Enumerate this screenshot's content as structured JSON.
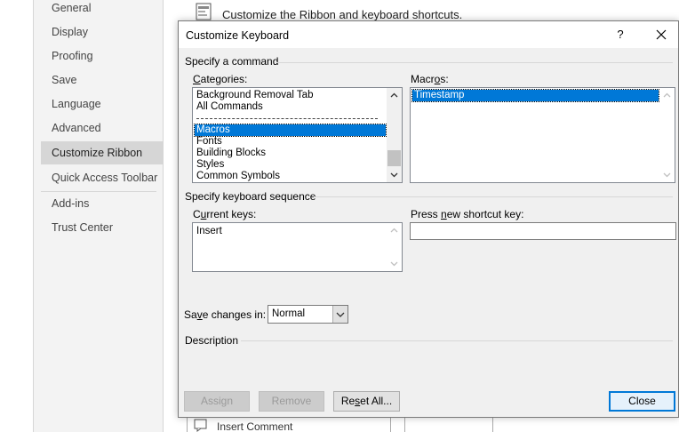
{
  "background_window": {
    "sidebar": {
      "items": [
        {
          "label": "General"
        },
        {
          "label": "Display"
        },
        {
          "label": "Proofing"
        },
        {
          "label": "Save"
        },
        {
          "label": "Language"
        },
        {
          "label": "Advanced"
        },
        {
          "label": "Customize Ribbon",
          "active": true
        },
        {
          "label": "Quick Access Toolbar"
        },
        {
          "label": "Add-ins"
        },
        {
          "label": "Trust Center"
        }
      ]
    },
    "header_text": "Customize the Ribbon and keyboard shortcuts.",
    "partial_list_item": "Insert Comment"
  },
  "dialog": {
    "title": "Customize Keyboard",
    "help_glyph": "?",
    "specify_command_label": "Specify a command",
    "categories": {
      "label_pre": "",
      "label_ul": "C",
      "label_post": "ategories:",
      "items": [
        "Background Removal Tab",
        "All Commands",
        "Macros",
        "Fonts",
        "Building Blocks",
        "Styles",
        "Common Symbols"
      ],
      "selected": "Macros"
    },
    "macros": {
      "label_pre": "Macr",
      "label_ul": "o",
      "label_post": "s:",
      "items": [
        "Timestamp"
      ],
      "selected": "Timestamp"
    },
    "keyboard_sequence_label": "Specify keyboard sequence",
    "current_keys": {
      "label_pre": "C",
      "label_ul": "u",
      "label_post": "rrent keys:",
      "items": [
        "Insert"
      ]
    },
    "new_shortcut": {
      "label_pre": "Press ",
      "label_ul": "n",
      "label_post": "ew shortcut key:",
      "value": ""
    },
    "save_changes": {
      "label_pre": "Sa",
      "label_ul": "v",
      "label_post": "e changes in:",
      "value": "Normal"
    },
    "description_label": "Description",
    "buttons": {
      "assign": "Assign",
      "remove": "Remove",
      "reset_pre": "Re",
      "reset_ul": "s",
      "reset_post": "et All...",
      "close": "Close"
    }
  },
  "colors": {
    "accent": "#0078d7",
    "dialog_bg": "#f0f0f0",
    "sidebar_active": "#d6d6d6"
  }
}
